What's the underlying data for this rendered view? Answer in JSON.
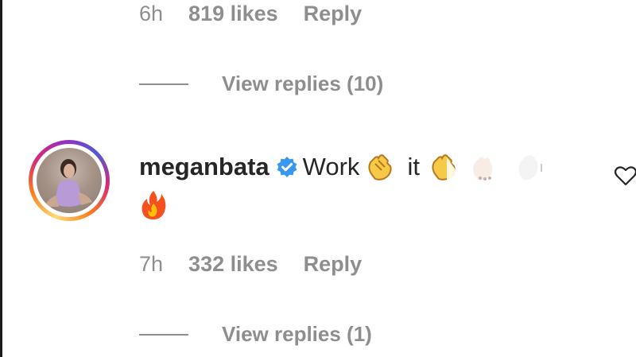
{
  "comment_above": {
    "time": "6h",
    "likes": "819 likes",
    "reply": "Reply",
    "view_replies": "View replies (10)"
  },
  "comment": {
    "username": "meganbata",
    "text_1": "Work",
    "text_2": "it",
    "emojis": [
      "clapping-hands",
      "clapping-hands",
      "clapping-hands-light",
      "clapping-hands-light",
      "fire"
    ],
    "time": "7h",
    "likes": "332 likes",
    "reply": "Reply",
    "view_replies": "View replies (1)"
  },
  "colors": {
    "secondary_text": "#8e8e8e",
    "primary_text": "#262626",
    "verified_blue": "#3897f0"
  }
}
